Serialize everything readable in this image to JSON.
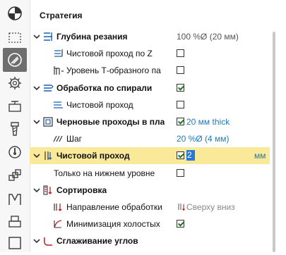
{
  "panel_title": "Стратегия",
  "toolbar": {
    "items": [
      {
        "name": "setup-icon"
      },
      {
        "name": "boundary-icon"
      },
      {
        "name": "strategy-icon",
        "active": true
      },
      {
        "name": "gear-icon"
      },
      {
        "name": "stock-icon"
      },
      {
        "name": "tool-icon"
      },
      {
        "name": "feed-icon"
      },
      {
        "name": "links-icon"
      },
      {
        "name": "macro-icon"
      },
      {
        "name": "print-icon"
      },
      {
        "name": "frame-icon"
      }
    ]
  },
  "rows": [
    {
      "id": "depth-of-cut",
      "label": "Глубина резания",
      "bold": true,
      "level": 0,
      "expanded": true,
      "value": "100 %Ø (20 мм)",
      "icon": "depth-icon"
    },
    {
      "id": "finish-z",
      "label": "Чистовой проход по Z",
      "level": 1,
      "checkbox": false,
      "icon": "finish-z-icon"
    },
    {
      "id": "t-slot-level",
      "label": "Уровень Т-образного па",
      "level": 1,
      "checkbox": false,
      "icon": "t-slot-icon"
    },
    {
      "id": "spiral",
      "label": "Обработка по спирали",
      "bold": true,
      "level": 0,
      "expanded": true,
      "checkbox": true,
      "icon": "spiral-icon"
    },
    {
      "id": "spiral-finish",
      "label": "Чистовой проход",
      "level": 1,
      "checkbox": false,
      "icon": "finish-pass-icon"
    },
    {
      "id": "rough-passes",
      "label": "Черновые проходы в пла",
      "bold": true,
      "level": 0,
      "expanded": true,
      "checkbox": true,
      "value": "20 мм thick",
      "icon": "rough-passes-icon"
    },
    {
      "id": "step",
      "label": "Шаг",
      "level": 1,
      "value": "20 %Ø (4 мм)",
      "icon": "step-icon"
    },
    {
      "id": "finish-pass",
      "label": "Чистовой проход",
      "bold": true,
      "level": 0,
      "expanded": true,
      "checkbox": true,
      "selected": true,
      "input": "2",
      "unit": "мм",
      "icon": "finish-depth-icon"
    },
    {
      "id": "bottom-only",
      "label": "Только на нижнем уровне",
      "level": 1,
      "checkbox": false,
      "icon": ""
    },
    {
      "id": "sorting",
      "label": "Сортировка",
      "bold": true,
      "level": 0,
      "expanded": true,
      "icon": "sort-icon"
    },
    {
      "id": "direction",
      "label": "Направление обработки",
      "level": 1,
      "value": "Сверху вниз",
      "icon": "direction-icon"
    },
    {
      "id": "minimize-idle",
      "label": "Минимизация холостых",
      "level": 1,
      "checkbox": true,
      "icon": "minimize-icon"
    },
    {
      "id": "corner-smoothing",
      "label": "Сглаживание углов",
      "bold": true,
      "level": 0,
      "expanded": true,
      "icon": "corner-icon"
    }
  ]
}
